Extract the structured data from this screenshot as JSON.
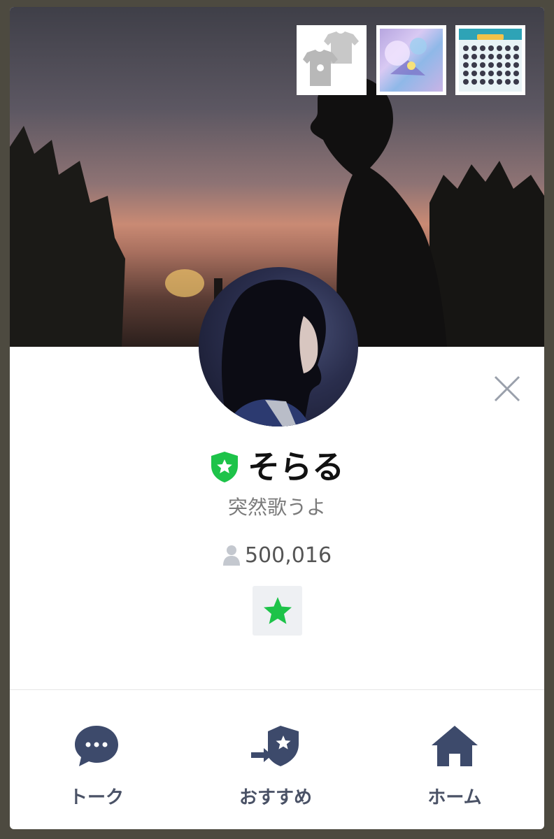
{
  "profile": {
    "name": "そらる",
    "status_message": "突然歌うよ",
    "friend_count": "500,016"
  },
  "icons": {
    "verified": "official-shield-star-icon",
    "friends": "person-icon",
    "favorite": "star-icon",
    "close": "close-x-icon"
  },
  "tabs": [
    {
      "label": "トーク",
      "icon": "chat-bubble-icon"
    },
    {
      "label": "おすすめ",
      "icon": "share-shield-icon"
    },
    {
      "label": "ホーム",
      "icon": "house-icon"
    }
  ],
  "colors": {
    "accent_green": "#1dc349",
    "tab_icon": "#3d4a6b",
    "card_background": "#ffffff",
    "backdrop": "#4d4a40"
  }
}
